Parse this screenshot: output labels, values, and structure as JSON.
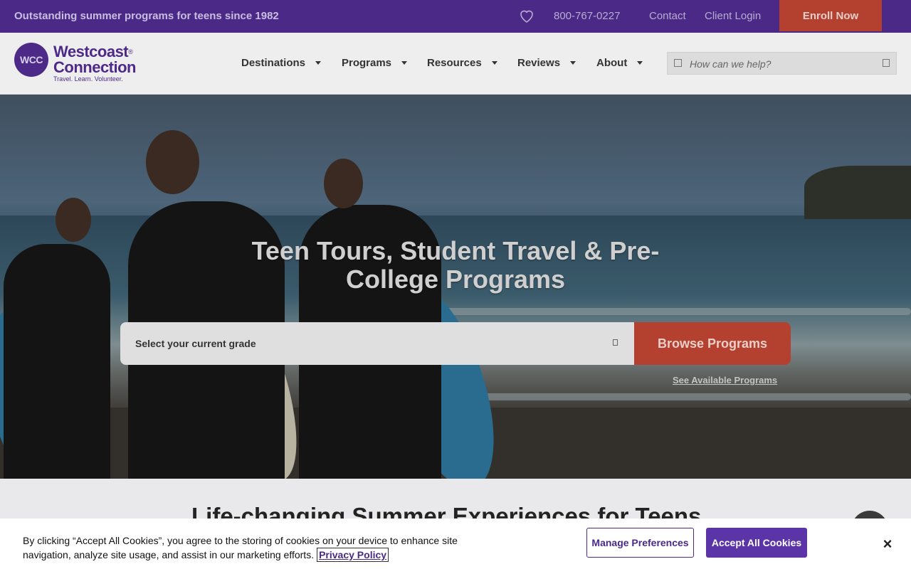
{
  "topbar": {
    "tagline": "Outstanding summer programs for teens since 1982",
    "phone": "800-767-0227",
    "contact": "Contact",
    "client_login": "Client Login",
    "enroll": "Enroll Now"
  },
  "header": {
    "logo_initials": "WCC",
    "logo_line1": "Westcoast",
    "logo_line2": "Connection",
    "logo_tagline": "Travel. Learn. Volunteer.",
    "nav": [
      "Destinations",
      "Programs",
      "Resources",
      "Reviews",
      "About"
    ],
    "search_placeholder": "How can we help?"
  },
  "hero": {
    "title": "Teen Tours, Student Travel & Pre-College Programs",
    "grade_select": "Select your current grade",
    "browse_button": "Browse Programs",
    "see_available": "See Available Programs"
  },
  "section": {
    "heading": "Life-changing Summer Experiences for Teens"
  },
  "cookie": {
    "text": "By clicking “Accept All Cookies”, you agree to the storing of cookies on your device to enhance site navigation, analyze site usage, and assist in our marketing efforts.",
    "privacy_link": "Privacy Policy",
    "manage": "Manage Preferences",
    "accept": "Accept All Cookies",
    "close": "×"
  },
  "colors": {
    "brand_purple": "#4a2a86",
    "accent_red": "#b4412f"
  }
}
